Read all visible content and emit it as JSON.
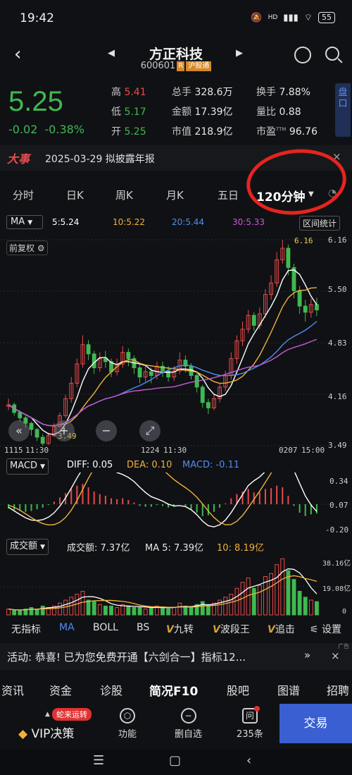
{
  "status": {
    "time": "19:42",
    "network": "HD",
    "battery": "55"
  },
  "header": {
    "name": "方正科技",
    "code": "600601",
    "tag_r": "R",
    "tag_hk": "沪股通"
  },
  "quote": {
    "price": "5.25",
    "change": "-0.02",
    "change_pct": "-0.38%",
    "high_label": "高",
    "high": "5.41",
    "low_label": "低",
    "low": "5.17",
    "open_label": "开",
    "open": "5.25",
    "volume_label": "总手",
    "volume": "328.6万",
    "amount_label": "金额",
    "amount": "17.39亿",
    "mktcap_label": "市值",
    "mktcap": "218.9亿",
    "turnover_label": "换手",
    "turnover": "7.88%",
    "vr_label": "量比",
    "vr": "0.88",
    "pe_label": "市盈",
    "pe_sup": "TTM",
    "pe": "96.76",
    "pankou": "盘口"
  },
  "event": {
    "tag": "大事",
    "text": "2025-03-29  拟披露年报",
    "close": "×"
  },
  "period_tabs": [
    "分时",
    "日K",
    "周K",
    "月K",
    "五日"
  ],
  "period_active": "120分钟",
  "ma_bar": {
    "select": "MA",
    "ma5": "5:5.24",
    "ma10": "10:5.22",
    "ma20": "20:5.44",
    "ma30": "30:5.33",
    "range_stat": "区间统计",
    "fq": "前复权"
  },
  "axes": {
    "price_ticks": [
      "6.16",
      "5.50",
      "4.83",
      "4.16",
      "3.49"
    ],
    "high_label": "6.16",
    "low_label": "3.49",
    "time_ticks": [
      "1115",
      "11:30",
      "1224",
      "11:30",
      "0207",
      "15:00"
    ],
    "macd_ticks": [
      "0.34",
      "0.07",
      "-0.20"
    ],
    "vol_ticks": [
      "38.16亿",
      "19.08亿",
      "0"
    ]
  },
  "macd": {
    "select": "MACD",
    "diff": "DIFF: 0.05",
    "dea": "DEA: 0.10",
    "macd": "MACD: -0.11"
  },
  "volume_ind": {
    "select": "成交额",
    "amount": "成交额: 7.37亿",
    "ma5": "MA 5: 7.39亿",
    "ma10": "10: 8.19亿"
  },
  "indicator_tabs": [
    "无指标",
    "MA",
    "BOLL",
    "BS",
    "九转",
    "波段王",
    "追击"
  ],
  "indicator_settings": "设置",
  "activity": {
    "text": "活动: 恭喜! 已为您免费开通【六剑合一】指标12...",
    "more": "»",
    "close": "×",
    "ad": "广告"
  },
  "f10_tabs": [
    "资讯",
    "资金",
    "诊股",
    "简况F10",
    "股吧",
    "图谱",
    "招聘"
  ],
  "toolbar": {
    "vip_badge": "蛇来运转",
    "vip": "VIP决策",
    "func": "功能",
    "remove": "删自选",
    "ask": "235条",
    "ask_icon": "问",
    "trade": "交易"
  },
  "colors": {
    "up": "#e84b4b",
    "down": "#3fb950",
    "ma5": "#ffffff",
    "ma10": "#f0b13e",
    "ma20": "#4f8df5",
    "ma30": "#c55bd6"
  },
  "chart_data": {
    "type": "candlestick",
    "y_range": [
      3.49,
      6.16
    ],
    "candles": [
      [
        4.0,
        4.02,
        3.95,
        4.1
      ],
      [
        4.02,
        3.92,
        3.88,
        4.05
      ],
      [
        3.92,
        3.85,
        3.8,
        3.95
      ],
      [
        3.85,
        3.78,
        3.72,
        3.88
      ],
      [
        3.78,
        3.7,
        3.62,
        3.8
      ],
      [
        3.7,
        3.6,
        3.55,
        3.72
      ],
      [
        3.6,
        3.52,
        3.49,
        3.64
      ],
      [
        3.52,
        3.62,
        3.5,
        3.66
      ],
      [
        3.62,
        3.74,
        3.6,
        3.78
      ],
      [
        3.74,
        3.88,
        3.72,
        3.92
      ],
      [
        3.88,
        4.1,
        3.85,
        4.15
      ],
      [
        4.1,
        4.3,
        4.05,
        4.38
      ],
      [
        4.3,
        4.55,
        4.25,
        4.62
      ],
      [
        4.55,
        4.8,
        4.5,
        4.92
      ],
      [
        4.8,
        4.68,
        4.6,
        4.86
      ],
      [
        4.68,
        4.5,
        4.42,
        4.72
      ],
      [
        4.5,
        4.62,
        4.45,
        4.7
      ],
      [
        4.62,
        4.58,
        4.5,
        4.72
      ],
      [
        4.58,
        4.45,
        4.38,
        4.62
      ],
      [
        4.45,
        4.55,
        4.4,
        4.62
      ],
      [
        4.55,
        4.7,
        4.5,
        4.78
      ],
      [
        4.7,
        4.62,
        4.52,
        4.75
      ],
      [
        4.62,
        4.5,
        4.42,
        4.66
      ],
      [
        4.5,
        4.38,
        4.3,
        4.54
      ],
      [
        4.38,
        4.45,
        4.32,
        4.52
      ],
      [
        4.45,
        4.4,
        4.3,
        4.5
      ],
      [
        4.4,
        4.52,
        4.35,
        4.58
      ],
      [
        4.52,
        4.46,
        4.38,
        4.58
      ],
      [
        4.46,
        4.38,
        4.32,
        4.52
      ],
      [
        4.38,
        4.46,
        4.33,
        4.52
      ],
      [
        4.46,
        4.6,
        4.42,
        4.7
      ],
      [
        4.6,
        4.52,
        4.44,
        4.66
      ],
      [
        4.52,
        4.4,
        4.35,
        4.56
      ],
      [
        4.4,
        4.25,
        4.18,
        4.44
      ],
      [
        4.25,
        4.05,
        3.98,
        4.28
      ],
      [
        4.05,
        3.98,
        3.9,
        4.1
      ],
      [
        3.98,
        4.1,
        3.95,
        4.15
      ],
      [
        4.1,
        4.25,
        4.05,
        4.3
      ],
      [
        4.25,
        4.4,
        4.2,
        4.46
      ],
      [
        4.4,
        4.62,
        4.35,
        4.7
      ],
      [
        4.62,
        4.85,
        4.55,
        4.92
      ],
      [
        4.85,
        5.0,
        4.78,
        5.1
      ],
      [
        5.0,
        5.18,
        4.95,
        5.25
      ],
      [
        5.18,
        5.05,
        4.98,
        5.22
      ],
      [
        5.05,
        5.2,
        5.0,
        5.28
      ],
      [
        5.2,
        5.45,
        5.15,
        5.52
      ],
      [
        5.45,
        5.6,
        5.38,
        5.7
      ],
      [
        5.6,
        5.9,
        5.55,
        6.0
      ],
      [
        5.9,
        6.05,
        5.85,
        6.16
      ],
      [
        6.05,
        5.8,
        5.7,
        6.1
      ],
      [
        5.8,
        5.5,
        5.4,
        5.85
      ],
      [
        5.5,
        5.3,
        5.2,
        5.56
      ],
      [
        5.3,
        5.22,
        5.1,
        5.38
      ],
      [
        5.22,
        5.32,
        5.15,
        5.4
      ],
      [
        5.32,
        5.25,
        5.17,
        5.41
      ]
    ],
    "macd_hist": [
      -0.05,
      -0.07,
      -0.08,
      -0.09,
      -0.08,
      -0.06,
      -0.04,
      -0.01,
      0.03,
      0.08,
      0.13,
      0.18,
      0.22,
      0.24,
      0.2,
      0.15,
      0.12,
      0.1,
      0.07,
      0.06,
      0.07,
      0.05,
      0.02,
      -0.02,
      -0.03,
      -0.03,
      -0.01,
      -0.02,
      -0.04,
      -0.03,
      0.0,
      -0.02,
      -0.06,
      -0.1,
      -0.14,
      -0.13,
      -0.09,
      -0.04,
      0.01,
      0.07,
      0.12,
      0.15,
      0.18,
      0.14,
      0.14,
      0.18,
      0.19,
      0.22,
      0.2,
      0.1,
      -0.02,
      -0.1,
      -0.14,
      -0.12,
      -0.11
    ],
    "volume": [
      4,
      3,
      3,
      4,
      5,
      4,
      6,
      5,
      6,
      8,
      10,
      12,
      14,
      16,
      10,
      9,
      7,
      6,
      6,
      5,
      7,
      6,
      5,
      5,
      4,
      5,
      6,
      5,
      4,
      5,
      8,
      6,
      5,
      7,
      9,
      7,
      8,
      10,
      12,
      14,
      18,
      22,
      25,
      18,
      20,
      26,
      28,
      34,
      38,
      30,
      24,
      16,
      12,
      10,
      9
    ]
  }
}
